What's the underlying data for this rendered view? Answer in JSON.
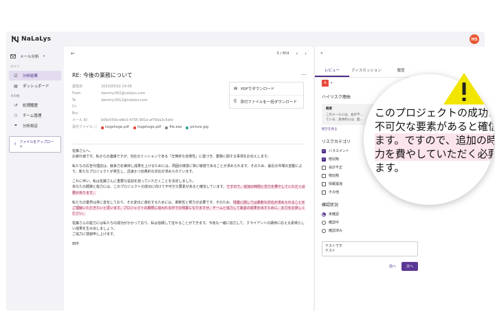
{
  "app": {
    "name": "NaLaLys",
    "avatar_initials": "HS",
    "accent_color": "#4a2a86",
    "avatar_color": "#e8562f"
  },
  "sidebar": {
    "mail_analysis": "メール分析",
    "section_main": "メイン",
    "main_items": [
      {
        "label": "分析結果",
        "icon": "checkbox-icon",
        "active": true
      },
      {
        "label": "ダッシュボード",
        "icon": "document-icon",
        "active": false
      }
    ],
    "section_other": "その他",
    "other_items": [
      {
        "label": "処理履歴",
        "icon": "history-icon"
      },
      {
        "label": "チーム管理",
        "icon": "team-icon"
      },
      {
        "label": "分析設定",
        "icon": "filter-icon"
      }
    ],
    "upload_label": "ファイルをアップロード"
  },
  "email": {
    "pager": "5 / 654",
    "subject": "RE: 今後の業務について",
    "meta": [
      {
        "key": "送信日",
        "value": "2023/05/02 14:06"
      },
      {
        "key": "From",
        "value": "dammy.002@nalalys.com"
      },
      {
        "key": "To",
        "value": "dammy.0012@nalalys.com"
      },
      {
        "key": "Cc",
        "value": ""
      },
      {
        "key": "Bcc",
        "value": ""
      },
      {
        "key": "メール ID",
        "value": "b06c050e-b8e3-4795-981e-af76da3c5afd"
      }
    ],
    "attachments_label": "添付ファイル",
    "attachments": [
      {
        "name": "hogehoge.pdf",
        "color": "#e84a3c"
      },
      {
        "name": "hogehoge.pdf",
        "color": "#e84a3c"
      },
      {
        "name": "file.exe",
        "color": "#888888"
      },
      {
        "name": "picture.jpg",
        "color": "#3aa39a"
      }
    ],
    "download_pdf": "PDFでダウンロード",
    "download_attachments": "添付ファイルを一括ダウンロード",
    "body": {
      "p1": [
        "佐藤さんへ、",
        "お疲れ様です。私からの連絡ですが、当社のミッションである「圧倒的な自発性」に基づき、業務に関する事項をお伝えします。"
      ],
      "p2": "私たちの広告代理店は、競争力を維持し成果を上げるためには、周囲の環境に常に敏感であることが求められます。そのため、最近の市場の変動により、新たなプロジェクトが発生し、迅速かつ効果的な対応が求められています。",
      "p3_a": "これに伴い、私は佐藤さんに重要な役割を担っていただくことを決定しました。",
      "p3_b": "あなたの経験と能力には、このプロジェクトの成功に向けて不可欠な要素があると確信しています。",
      "p3_hl": "ですので、追加の時間と労力を費やしていただく必要があります。",
      "p4_a": "私たちの業界は常に変化しており、その変化に適応するためには、柔軟性と努力が必要です。そのため、",
      "p4_hl": "残業に関しては柔軟な対応が求められることをご理解いただきたいと思います。プロジェクトの期限に追われる中での残業になりますが、チームと協力して最善の成果を出すために、お力をお貸しください。",
      "p5": [
        "佐藤さんの能力には私たちの成功がかかっており、私は信頼して任せることができます。今後も一緒に協力して、クライアントの期待に応える素晴らしい成果を生み出しましょう。",
        "ご協力に感謝申し上げます。"
      ],
      "signature": "田中"
    }
  },
  "panel": {
    "tabs": [
      "レビュー",
      "ディスカッション",
      "履歴"
    ],
    "pdf_badge": "A",
    "high_risk_heading": "ハイリスク理由",
    "summary_title": "概要",
    "summary_text": "このメールには、会計不…",
    "summary_text2": "ている、具体的には、超…",
    "read_more": "続きを見る",
    "risk_category_heading": "リスクカテゴリ",
    "risk_categories": [
      {
        "label": "ハラスメント",
        "checked": true
      },
      {
        "label": "贈収賄",
        "checked": true
      },
      {
        "label": "会計不正",
        "checked": false
      },
      {
        "label": "贈収賄",
        "checked": false
      },
      {
        "label": "情報漏洩",
        "checked": false
      },
      {
        "label": "その他",
        "checked": false
      }
    ],
    "status_heading": "確認状況",
    "statuses": [
      {
        "label": "未確認",
        "checked": true
      },
      {
        "label": "確認中",
        "checked": false
      },
      {
        "label": "確認済み",
        "checked": false
      }
    ],
    "memo_text": [
      "テストです",
      "テスト"
    ],
    "prev_button": "前へ",
    "next_button": "次へ"
  },
  "magnifier": {
    "ghost_text": "会計不",
    "lines": [
      "このプロジェクトの成功に",
      "不可欠な要素があると確信",
      "ます。ですので、追加の時間",
      "力を費やしていただく必要が",
      "ます。"
    ]
  }
}
